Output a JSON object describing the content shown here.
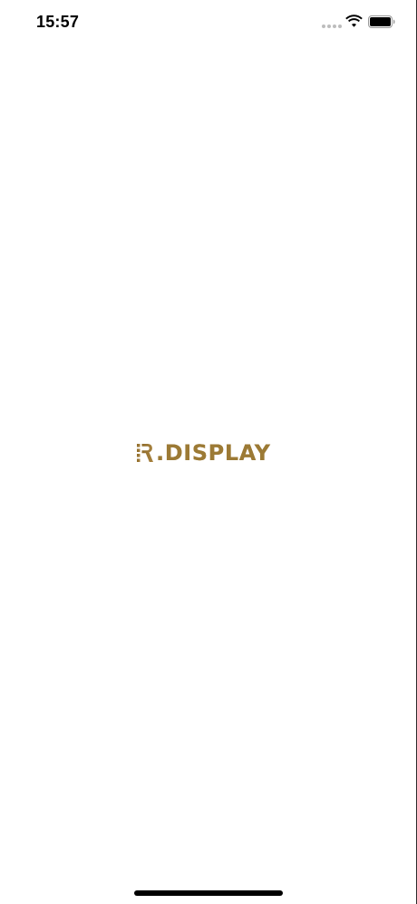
{
  "status_bar": {
    "time": "15:57",
    "icons": [
      "signal-dots-icon",
      "wifi-icon",
      "battery-icon"
    ]
  },
  "splash": {
    "logo_text": ".DISPLAY",
    "logo_mark": "R",
    "brand_color": "#9c7a35"
  }
}
